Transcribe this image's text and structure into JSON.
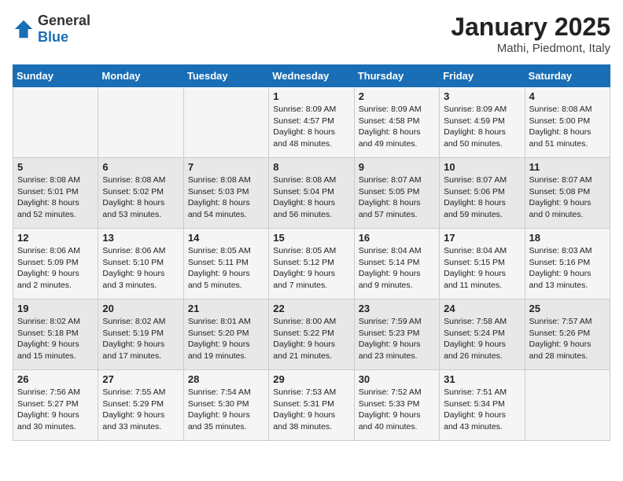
{
  "header": {
    "logo_general": "General",
    "logo_blue": "Blue",
    "title": "January 2025",
    "subtitle": "Mathi, Piedmont, Italy"
  },
  "weekdays": [
    "Sunday",
    "Monday",
    "Tuesday",
    "Wednesday",
    "Thursday",
    "Friday",
    "Saturday"
  ],
  "weeks": [
    [
      {
        "day": "",
        "info": ""
      },
      {
        "day": "",
        "info": ""
      },
      {
        "day": "",
        "info": ""
      },
      {
        "day": "1",
        "info": "Sunrise: 8:09 AM\nSunset: 4:57 PM\nDaylight: 8 hours\nand 48 minutes."
      },
      {
        "day": "2",
        "info": "Sunrise: 8:09 AM\nSunset: 4:58 PM\nDaylight: 8 hours\nand 49 minutes."
      },
      {
        "day": "3",
        "info": "Sunrise: 8:09 AM\nSunset: 4:59 PM\nDaylight: 8 hours\nand 50 minutes."
      },
      {
        "day": "4",
        "info": "Sunrise: 8:08 AM\nSunset: 5:00 PM\nDaylight: 8 hours\nand 51 minutes."
      }
    ],
    [
      {
        "day": "5",
        "info": "Sunrise: 8:08 AM\nSunset: 5:01 PM\nDaylight: 8 hours\nand 52 minutes."
      },
      {
        "day": "6",
        "info": "Sunrise: 8:08 AM\nSunset: 5:02 PM\nDaylight: 8 hours\nand 53 minutes."
      },
      {
        "day": "7",
        "info": "Sunrise: 8:08 AM\nSunset: 5:03 PM\nDaylight: 8 hours\nand 54 minutes."
      },
      {
        "day": "8",
        "info": "Sunrise: 8:08 AM\nSunset: 5:04 PM\nDaylight: 8 hours\nand 56 minutes."
      },
      {
        "day": "9",
        "info": "Sunrise: 8:07 AM\nSunset: 5:05 PM\nDaylight: 8 hours\nand 57 minutes."
      },
      {
        "day": "10",
        "info": "Sunrise: 8:07 AM\nSunset: 5:06 PM\nDaylight: 8 hours\nand 59 minutes."
      },
      {
        "day": "11",
        "info": "Sunrise: 8:07 AM\nSunset: 5:08 PM\nDaylight: 9 hours\nand 0 minutes."
      }
    ],
    [
      {
        "day": "12",
        "info": "Sunrise: 8:06 AM\nSunset: 5:09 PM\nDaylight: 9 hours\nand 2 minutes."
      },
      {
        "day": "13",
        "info": "Sunrise: 8:06 AM\nSunset: 5:10 PM\nDaylight: 9 hours\nand 3 minutes."
      },
      {
        "day": "14",
        "info": "Sunrise: 8:05 AM\nSunset: 5:11 PM\nDaylight: 9 hours\nand 5 minutes."
      },
      {
        "day": "15",
        "info": "Sunrise: 8:05 AM\nSunset: 5:12 PM\nDaylight: 9 hours\nand 7 minutes."
      },
      {
        "day": "16",
        "info": "Sunrise: 8:04 AM\nSunset: 5:14 PM\nDaylight: 9 hours\nand 9 minutes."
      },
      {
        "day": "17",
        "info": "Sunrise: 8:04 AM\nSunset: 5:15 PM\nDaylight: 9 hours\nand 11 minutes."
      },
      {
        "day": "18",
        "info": "Sunrise: 8:03 AM\nSunset: 5:16 PM\nDaylight: 9 hours\nand 13 minutes."
      }
    ],
    [
      {
        "day": "19",
        "info": "Sunrise: 8:02 AM\nSunset: 5:18 PM\nDaylight: 9 hours\nand 15 minutes."
      },
      {
        "day": "20",
        "info": "Sunrise: 8:02 AM\nSunset: 5:19 PM\nDaylight: 9 hours\nand 17 minutes."
      },
      {
        "day": "21",
        "info": "Sunrise: 8:01 AM\nSunset: 5:20 PM\nDaylight: 9 hours\nand 19 minutes."
      },
      {
        "day": "22",
        "info": "Sunrise: 8:00 AM\nSunset: 5:22 PM\nDaylight: 9 hours\nand 21 minutes."
      },
      {
        "day": "23",
        "info": "Sunrise: 7:59 AM\nSunset: 5:23 PM\nDaylight: 9 hours\nand 23 minutes."
      },
      {
        "day": "24",
        "info": "Sunrise: 7:58 AM\nSunset: 5:24 PM\nDaylight: 9 hours\nand 26 minutes."
      },
      {
        "day": "25",
        "info": "Sunrise: 7:57 AM\nSunset: 5:26 PM\nDaylight: 9 hours\nand 28 minutes."
      }
    ],
    [
      {
        "day": "26",
        "info": "Sunrise: 7:56 AM\nSunset: 5:27 PM\nDaylight: 9 hours\nand 30 minutes."
      },
      {
        "day": "27",
        "info": "Sunrise: 7:55 AM\nSunset: 5:29 PM\nDaylight: 9 hours\nand 33 minutes."
      },
      {
        "day": "28",
        "info": "Sunrise: 7:54 AM\nSunset: 5:30 PM\nDaylight: 9 hours\nand 35 minutes."
      },
      {
        "day": "29",
        "info": "Sunrise: 7:53 AM\nSunset: 5:31 PM\nDaylight: 9 hours\nand 38 minutes."
      },
      {
        "day": "30",
        "info": "Sunrise: 7:52 AM\nSunset: 5:33 PM\nDaylight: 9 hours\nand 40 minutes."
      },
      {
        "day": "31",
        "info": "Sunrise: 7:51 AM\nSunset: 5:34 PM\nDaylight: 9 hours\nand 43 minutes."
      },
      {
        "day": "",
        "info": ""
      }
    ]
  ]
}
